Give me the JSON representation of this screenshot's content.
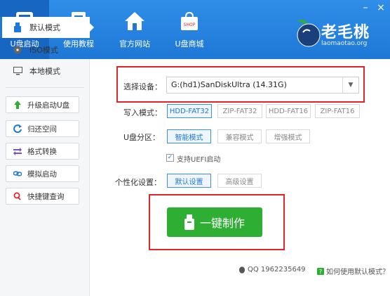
{
  "header": {
    "nav": [
      {
        "label": "U盘启动",
        "icon": "usb-boot-icon"
      },
      {
        "label": "使用教程",
        "icon": "document-icon"
      },
      {
        "label": "官方网站",
        "icon": "home-icon"
      },
      {
        "label": "U盘商城",
        "icon": "shop-bag-icon",
        "icon_text": "SHOP"
      }
    ],
    "minimize": "–",
    "close": "×",
    "logo_text": "老毛桃",
    "logo_sub": "laomaotao.org"
  },
  "sidebar": {
    "modes": [
      {
        "label": "默认模式",
        "icon": "usb-icon",
        "active": true
      },
      {
        "label": "ISO模式",
        "icon": "disc-icon",
        "active": false
      },
      {
        "label": "本地模式",
        "icon": "monitor-icon",
        "active": false
      }
    ],
    "buttons": [
      {
        "label": "升级启动U盘",
        "icon": "arrow-up-icon"
      },
      {
        "label": "归还空间",
        "icon": "refresh-icon"
      },
      {
        "label": "格式转换",
        "icon": "convert-icon"
      },
      {
        "label": "模拟启动",
        "icon": "link-icon"
      },
      {
        "label": "快捷键查询",
        "icon": "search-icon"
      }
    ]
  },
  "main": {
    "device_label": "选择设备：",
    "device_value": "G:(hd1)SanDiskUltra (14.31G)",
    "write_label": "写入模式：",
    "write_options": [
      "HDD-FAT32",
      "ZIP-FAT32",
      "HDD-FAT16",
      "ZIP-FAT16"
    ],
    "write_selected": "HDD-FAT32",
    "partition_label": "U盘分区：",
    "partition_options": [
      "智能模式",
      "兼容模式",
      "增强模式"
    ],
    "partition_selected": "智能模式",
    "uefi_label": "支持UEFI启动",
    "uefi_checked": true,
    "personal_label": "个性化设置：",
    "personal_options": [
      "默认设置",
      "高级设置"
    ],
    "personal_selected": "默认设置",
    "make_button": "一键制作",
    "qq_text": "QQ 1962235649",
    "help_text": "如何使用默认模式？"
  },
  "colors": {
    "header": "#1e78d6",
    "make_button": "#2fae34",
    "highlight_box": "#e0262a"
  }
}
